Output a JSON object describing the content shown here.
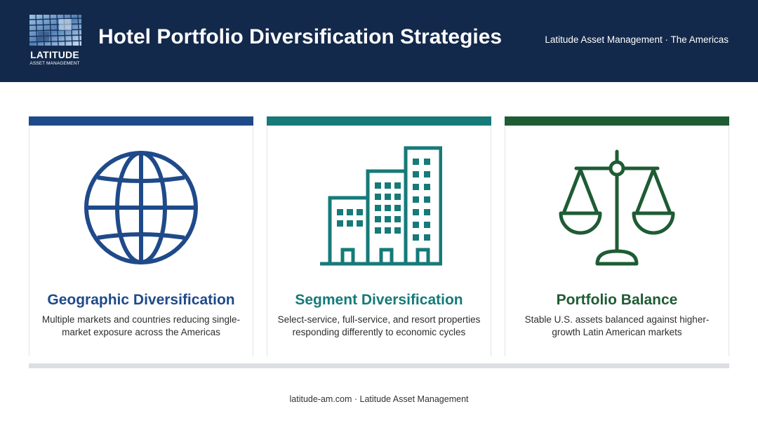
{
  "header": {
    "title": "Hotel Portfolio Diversification Strategies",
    "tagline": "Latitude Asset Management · The Americas",
    "background_color": "#13294b"
  },
  "logo": {
    "wordmark": "LATITUDE",
    "subtitle": "ASSET MANAGEMENT",
    "icon": "building-facade-photo"
  },
  "cards": [
    {
      "title": "Geographic Diversification",
      "description": "Multiple markets and countries reducing single-market exposure across the Americas",
      "icon": "globe-icon",
      "color": "#1f4a8a"
    },
    {
      "title": "Segment Diversification",
      "description": "Select-service, full-service, and resort properties responding differently to economic cycles",
      "icon": "buildings-icon",
      "color": "#167a78"
    },
    {
      "title": "Portfolio Balance",
      "description": "Stable U.S. assets balanced against higher-growth Latin American markets",
      "icon": "scales-icon",
      "color": "#1e5c34"
    }
  ],
  "footer": {
    "text": "latitude-am.com · Latitude Asset Management"
  }
}
